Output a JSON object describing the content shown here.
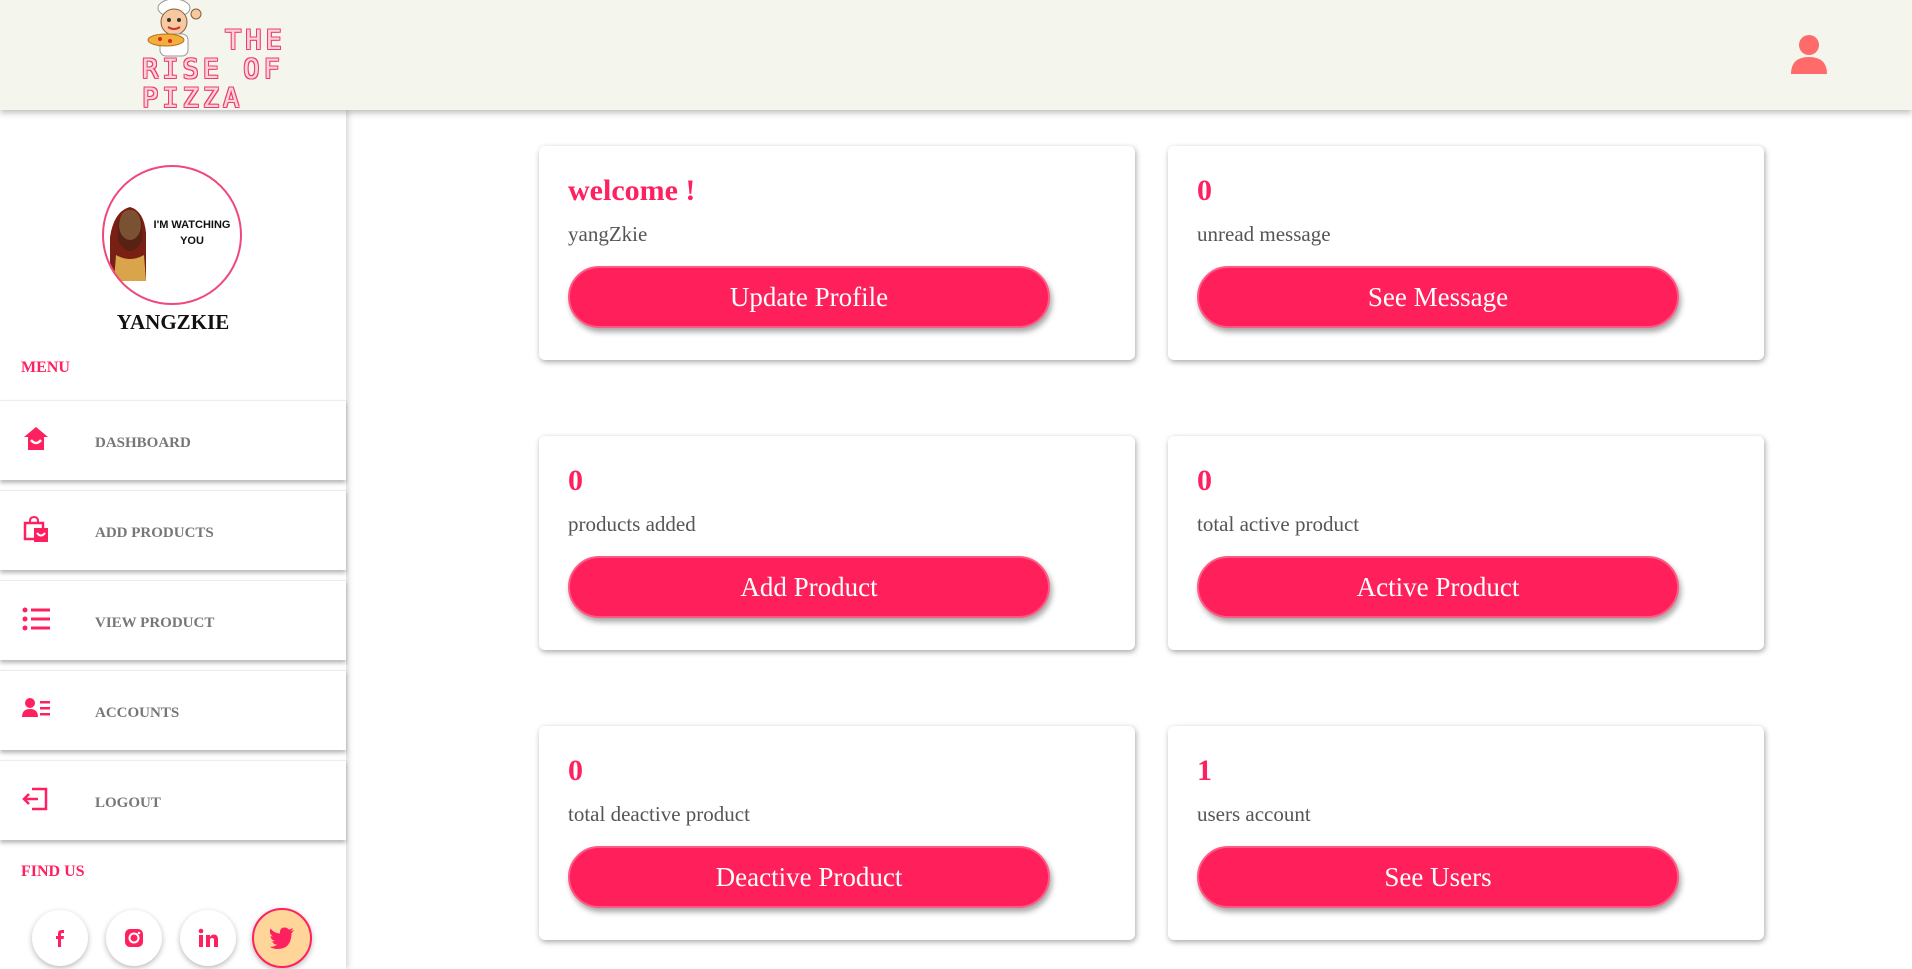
{
  "brand": {
    "line1": "THE",
    "line2": "RISE OF PIZZA"
  },
  "profile": {
    "avatar_caption": "I'M WATCHING YOU",
    "username": "yangZkie"
  },
  "sidebar": {
    "menu_heading": "MENU",
    "items": [
      {
        "label": "DASHBOARD",
        "icon": "home-icon"
      },
      {
        "label": "ADD PRODUCTS",
        "icon": "shopping-bag-icon"
      },
      {
        "label": "VIEW PRODUCT",
        "icon": "list-icon"
      },
      {
        "label": "ACCOUNTS",
        "icon": "user-list-icon"
      },
      {
        "label": "LOGOUT",
        "icon": "logout-icon"
      }
    ],
    "find_us_heading": "FIND US",
    "socials": [
      "facebook-icon",
      "instagram-icon",
      "linkedin-icon",
      "twitter-icon"
    ]
  },
  "cards": [
    {
      "value": "welcome !",
      "label": "yangZkie",
      "button": "Update Profile"
    },
    {
      "value": "0",
      "label": "unread message",
      "button": "See Message"
    },
    {
      "value": "0",
      "label": "products added",
      "button": "Add Product"
    },
    {
      "value": "0",
      "label": "total active product",
      "button": "Active Product"
    },
    {
      "value": "0",
      "label": "total deactive product",
      "button": "Deactive Product"
    },
    {
      "value": "1",
      "label": "users account",
      "button": "See Users"
    }
  ],
  "colors": {
    "accent": "#ff2060",
    "header_bg": "#f4f6ee",
    "button_bg": "#ff1f5a"
  }
}
